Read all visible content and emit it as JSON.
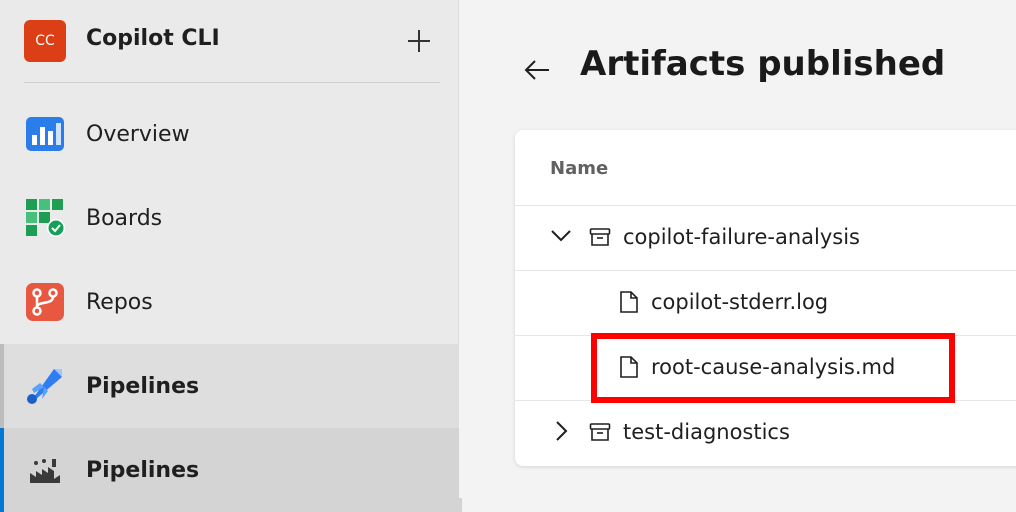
{
  "sidebar": {
    "project": {
      "initials": "CC",
      "name": "Copilot CLI",
      "avatar_color": "#dc3e15"
    },
    "items": [
      {
        "label": "Overview",
        "icon": "overview-icon"
      },
      {
        "label": "Boards",
        "icon": "boards-icon"
      },
      {
        "label": "Repos",
        "icon": "repos-icon"
      },
      {
        "label": "Pipelines",
        "icon": "pipelines-icon"
      },
      {
        "label": "Pipelines",
        "icon": "pipelines-sub-icon"
      }
    ]
  },
  "main": {
    "title": "Artifacts published",
    "table": {
      "column_name": "Name",
      "rows": [
        {
          "name": "copilot-failure-analysis",
          "type": "artifact",
          "expanded": true
        },
        {
          "name": "copilot-stderr.log",
          "type": "file"
        },
        {
          "name": "root-cause-analysis.md",
          "type": "file"
        },
        {
          "name": "test-diagnostics",
          "type": "artifact",
          "expanded": false
        }
      ]
    }
  },
  "colors": {
    "accent": "#0078d4",
    "highlight": "#ff0000"
  }
}
